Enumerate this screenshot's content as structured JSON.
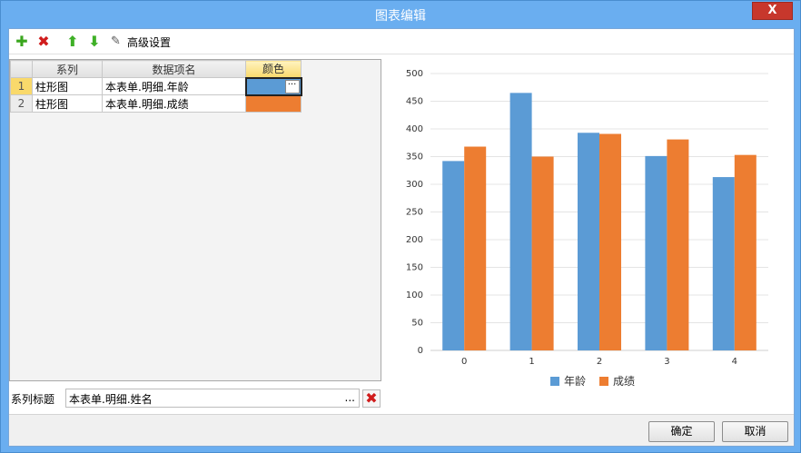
{
  "window": {
    "title": "图表编辑",
    "close_label": "X"
  },
  "toolbar": {
    "add_icon": "plus-icon",
    "delete_icon": "delete-x-icon",
    "up_icon": "arrow-up-icon",
    "down_icon": "arrow-down-icon",
    "advanced_label": "高级设置"
  },
  "grid": {
    "headers": {
      "series": "系列",
      "data_item": "数据项名",
      "color": "颜色"
    },
    "rows": [
      {
        "num": "1",
        "series": "柱形图",
        "data_item": "本表单.明细.年龄",
        "color": "#5b9bd5"
      },
      {
        "num": "2",
        "series": "柱形图",
        "data_item": "本表单.明细.成绩",
        "color": "#ed7d31"
      }
    ],
    "color_button_label": "···"
  },
  "series_title": {
    "label": "系列标题",
    "value": "本表单.明细.姓名",
    "ellipsis": "..."
  },
  "chart_data": {
    "type": "bar",
    "categories": [
      "0",
      "1",
      "2",
      "3",
      "4"
    ],
    "series": [
      {
        "name": "年龄",
        "color": "#5b9bd5",
        "values": [
          342,
          465,
          393,
          351,
          313
        ]
      },
      {
        "name": "成绩",
        "color": "#ed7d31",
        "values": [
          368,
          350,
          391,
          381,
          353
        ]
      }
    ],
    "ylim": [
      0,
      500
    ],
    "yticks": [
      0,
      50,
      100,
      150,
      200,
      250,
      300,
      350,
      400,
      450,
      500
    ],
    "grid": true,
    "legend": "bottom"
  },
  "buttons": {
    "ok": "确定",
    "cancel": "取消"
  }
}
